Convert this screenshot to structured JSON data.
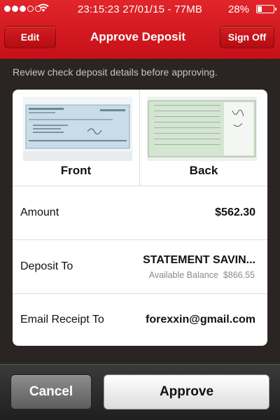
{
  "status_bar": {
    "time_text": "23:15:23 27/01/15 - 77MB",
    "battery_text": "28%",
    "battery_level": 0.28
  },
  "nav": {
    "title": "Approve Deposit",
    "edit_label": "Edit",
    "signoff_label": "Sign Off"
  },
  "instructions": "Review check deposit details before approving.",
  "images": {
    "front_label": "Front",
    "back_label": "Back"
  },
  "details": {
    "amount_label": "Amount",
    "amount_value": "$562.30",
    "deposit_to_label": "Deposit To",
    "deposit_to_value": "STATEMENT SAVIN...",
    "available_balance_label": "Available Balance",
    "available_balance_value": "$866.55",
    "email_label": "Email Receipt To",
    "email_value": "forexxin@gmail.com"
  },
  "actions": {
    "cancel_label": "Cancel",
    "approve_label": "Approve"
  },
  "colors": {
    "brand_red": "#d11a20",
    "check_blue": "#cfe0ea",
    "check_green": "#d6e8d6"
  },
  "icons": [
    "signal-dots-icon",
    "wifi-icon",
    "battery-icon"
  ]
}
